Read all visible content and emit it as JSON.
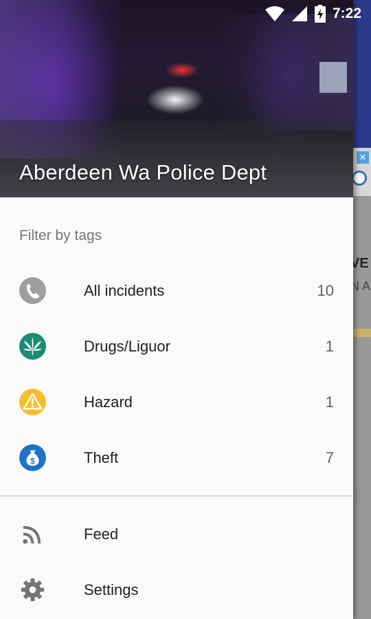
{
  "status_bar": {
    "time": "7:22"
  },
  "drawer": {
    "header_title": "Aberdeen Wa Police Dept",
    "filter_label": "Filter by tags",
    "tags": [
      {
        "label": "All incidents",
        "count": "10",
        "icon": "phone-icon",
        "color": "#9e9e9e"
      },
      {
        "label": "Drugs/Liguor",
        "count": "1",
        "icon": "cannabis-leaf-icon",
        "color": "#1a8c74"
      },
      {
        "label": "Hazard",
        "count": "1",
        "icon": "warning-icon",
        "color": "#f6c02b"
      },
      {
        "label": "Theft",
        "count": "7",
        "icon": "money-bag-icon",
        "color": "#1e73c8"
      }
    ],
    "menu": [
      {
        "label": "Feed",
        "icon": "rss-feed-icon"
      },
      {
        "label": "Settings",
        "icon": "gear-icon"
      }
    ]
  },
  "background": {
    "map_text_1": "VE",
    "map_text_2": "N A",
    "ad_close": "✕"
  }
}
